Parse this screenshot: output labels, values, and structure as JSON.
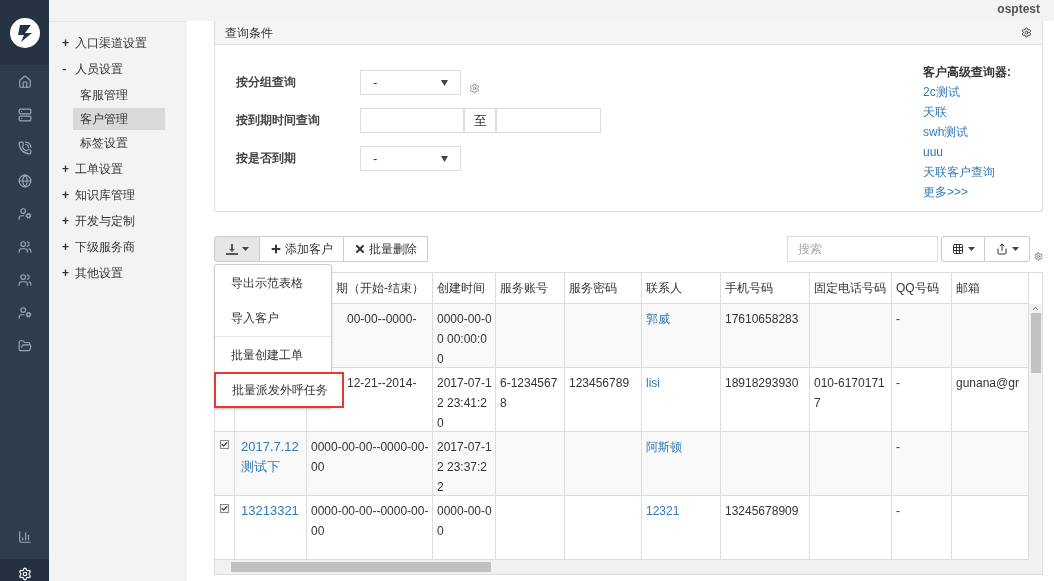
{
  "header": {
    "user": "osptest"
  },
  "menu": [
    {
      "label": "入口渠道设置",
      "expanded": false,
      "marker": "+"
    },
    {
      "label": "人员设置",
      "expanded": true,
      "marker": "-",
      "children": [
        {
          "label": "客服管理",
          "selected": false
        },
        {
          "label": "客户管理",
          "selected": true
        },
        {
          "label": "标签设置",
          "selected": false
        }
      ]
    },
    {
      "label": "工单设置",
      "expanded": false,
      "marker": "+"
    },
    {
      "label": "知识库管理",
      "expanded": false,
      "marker": "+"
    },
    {
      "label": "开发与定制",
      "expanded": false,
      "marker": "+"
    },
    {
      "label": "下级服务商",
      "expanded": false,
      "marker": "+"
    },
    {
      "label": "其他设置",
      "expanded": false,
      "marker": "+"
    }
  ],
  "query_panel": {
    "title": "查询条件",
    "fields": [
      {
        "label": "按分组查询",
        "kind": "select",
        "value": "-"
      },
      {
        "label": "按到期时间查询",
        "kind": "date_range",
        "separator": "至"
      },
      {
        "label": "按是否到期",
        "kind": "select",
        "value": "-"
      }
    ],
    "advanced": {
      "title": "客户高级查询器:",
      "links": [
        "2c测试",
        "天联",
        "swh测试",
        "uuu",
        "天联客户查询",
        "更多>>>"
      ]
    }
  },
  "toolbar": {
    "buttons": [
      "添加客户",
      "批量删除"
    ],
    "search": {
      "placeholder": "搜索"
    }
  },
  "dropdown": [
    {
      "label": "导出示范表格",
      "highlighted": false
    },
    {
      "label": "导入客户",
      "highlighted": false,
      "divider_after": true
    },
    {
      "label": "批量创建工单",
      "highlighted": false
    },
    {
      "label": "批量派发外呼任务",
      "highlighted": true
    }
  ],
  "table": {
    "columns": [
      {
        "label": "期（开始-结束）",
        "kind": "text"
      },
      {
        "label": "创建时间",
        "kind": "text"
      },
      {
        "label": "服务账号",
        "kind": "text"
      },
      {
        "label": "服务密码",
        "kind": "text"
      },
      {
        "label": "联系人",
        "kind": "link"
      },
      {
        "label": "手机号码",
        "kind": "text"
      },
      {
        "label": "固定电话号码",
        "kind": "text"
      },
      {
        "label": "QQ号码",
        "kind": "text"
      },
      {
        "label": "邮箱",
        "kind": "text"
      }
    ],
    "rows": [
      {
        "cells": [
          "00-00--0000-",
          "0000-00-00 00:00:00",
          null,
          null,
          "郭威",
          "17610658283",
          null,
          "-",
          null
        ]
      },
      {
        "cells": [
          "12-21--2014-",
          "2017-07-12 23:41:20",
          "6-12345678",
          "123456789",
          "lisi",
          "18918293930",
          "010-61701717",
          "-",
          "gunana@gr"
        ]
      },
      {
        "checked": true,
        "name": "2017.7.12测试下",
        "cells": [
          "0000-00-00--0000-00-00",
          "2017-07-12 23:37:22",
          null,
          null,
          "阿斯顿",
          null,
          null,
          "-",
          null
        ]
      },
      {
        "checked": true,
        "name": "13213321",
        "cells": [
          "0000-00-00--0000-00-00",
          "0000-00-00",
          null,
          null,
          "12321",
          "13245678909",
          null,
          "-",
          null
        ]
      }
    ]
  }
}
